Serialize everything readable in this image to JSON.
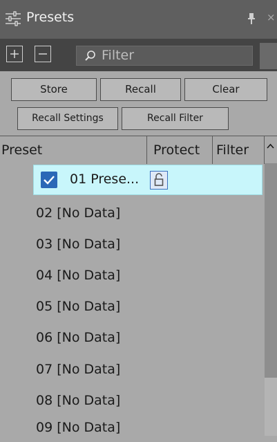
{
  "window": {
    "title": "Presets",
    "icons": {
      "title": "sliders-icon",
      "pin": "pin-icon",
      "close": "close-icon"
    },
    "close_glyph": "×"
  },
  "toolbar": {
    "add_icon": "plus-icon",
    "remove_icon": "minus-icon",
    "filter_placeholder": "Filter"
  },
  "buttons": {
    "store": "Store",
    "recall": "Recall",
    "clear": "Clear",
    "recall_settings": "Recall Settings",
    "recall_filter": "Recall Filter"
  },
  "table": {
    "columns": [
      "Preset",
      "Protect",
      "Filter"
    ],
    "selected_row": {
      "label": "01 Prese...",
      "checked": true,
      "protected_icon": "unlock-icon"
    },
    "rows": [
      "02 [No Data]",
      "03 [No Data]",
      "04 [No Data]",
      "05 [No Data]",
      "06 [No Data]",
      "07 [No Data]",
      "08 [No Data]",
      "09 [No Data]"
    ]
  },
  "colors": {
    "titlebar": "#5f5f5f",
    "toolbar": "#444444",
    "panel": "#a9a9a9",
    "selection": "#c8f6fb",
    "checkbox": "#2a68b7"
  }
}
